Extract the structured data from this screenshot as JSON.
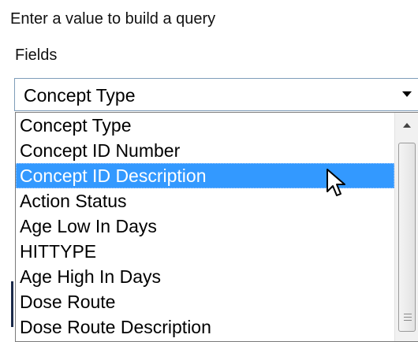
{
  "header": {
    "prompt": "Enter a value to build a query",
    "fields_label": "Fields"
  },
  "fields_select": {
    "selected_value": "Concept Type",
    "options": [
      "Concept Type",
      "Concept ID Number",
      "Concept ID Description",
      "Action Status",
      "Age Low In Days",
      "HITTYPE",
      "Age High In Days",
      "Dose Route",
      "Dose Route Description"
    ],
    "highlighted_index": 2
  },
  "colors": {
    "highlight": "#3399ff",
    "select_border": "#7f9db9"
  },
  "icons": [
    "dropdown-arrow-icon",
    "scroll-up-arrow-icon",
    "mouse-pointer-icon"
  ]
}
